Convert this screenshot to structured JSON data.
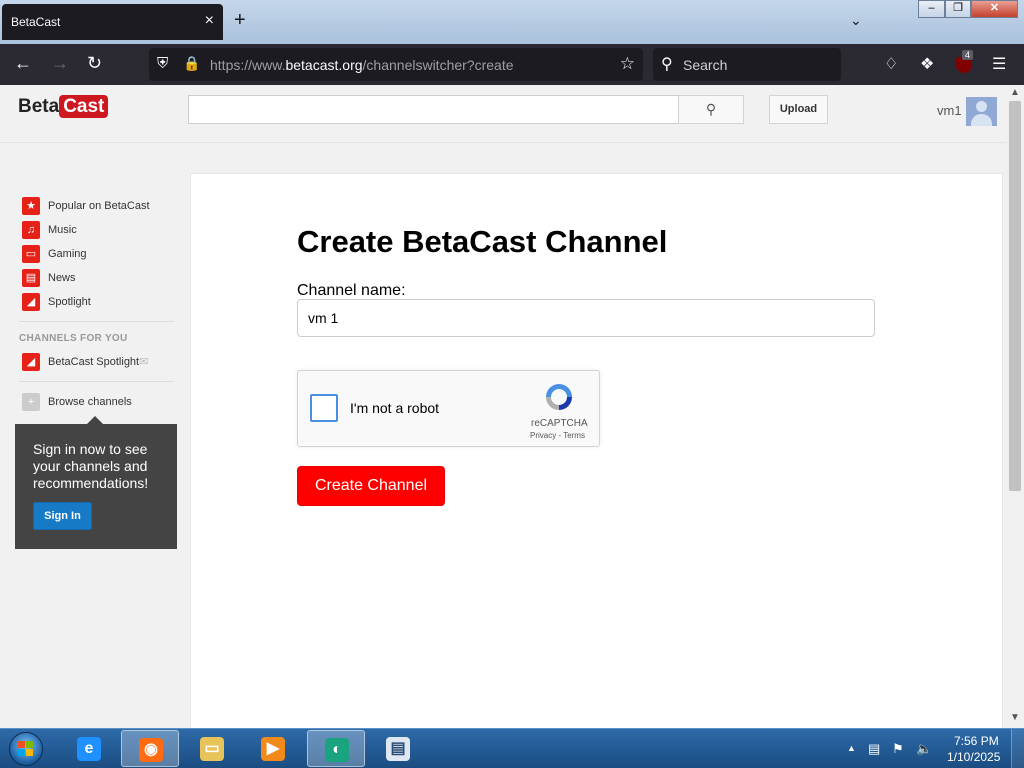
{
  "browser": {
    "tab_title": "BetaCast",
    "tab_close": "×",
    "new_tab": "+",
    "url_prefix": "https://www.",
    "url_domain": "betacast.org",
    "url_path": "/channelswitcher?create",
    "search_placeholder": "Search",
    "extension_badge": "4"
  },
  "site": {
    "logo_part1": "Beta",
    "logo_part2": "Cast",
    "search_value": "",
    "upload_label": "Upload",
    "username": "vm1"
  },
  "sidebar": {
    "guide": [
      {
        "label": "Popular on BetaCast",
        "icon": "star-icon",
        "color": "#e62117",
        "glyph": "★"
      },
      {
        "label": "Music",
        "icon": "headphones-icon",
        "color": "#e62117",
        "glyph": "♫"
      },
      {
        "label": "Gaming",
        "icon": "gamepad-icon",
        "color": "#e62117",
        "glyph": "▭"
      },
      {
        "label": "News",
        "icon": "newspaper-icon",
        "color": "#e62117",
        "glyph": "▤"
      },
      {
        "label": "Spotlight",
        "icon": "spotlight-icon",
        "color": "#e62117",
        "glyph": "◢"
      }
    ],
    "channels_heading": "CHANNELS FOR YOU",
    "channel_items": [
      {
        "label": "BetaCast Spotlight",
        "icon": "spotlight-icon",
        "color": "#e62117",
        "glyph": "◢"
      }
    ],
    "browse_label": "Browse channels",
    "signin_message": "Sign in now to see your channels and recommendations!",
    "signin_button": "Sign In"
  },
  "form": {
    "title": "Create BetaCast Channel",
    "channel_label": "Channel name:",
    "channel_value": "vm 1",
    "captcha_label": "I'm not a robot",
    "captcha_brand": "reCAPTCHA",
    "captcha_links": "Privacy - Terms",
    "submit_label": "Create Channel"
  },
  "taskbar": {
    "time": "7:56 PM",
    "date": "1/10/2025",
    "apps": [
      {
        "name": "ie-icon",
        "color": "#1e90ff",
        "glyph": "e"
      },
      {
        "name": "firefox-icon",
        "color": "#ff6a13",
        "glyph": "◉",
        "active": true
      },
      {
        "name": "file-explorer-icon",
        "color": "#e7c35a",
        "glyph": "▭"
      },
      {
        "name": "media-player-icon",
        "color": "#f28a1b",
        "glyph": "▶"
      },
      {
        "name": "remote-app-icon",
        "color": "#19a37e",
        "glyph": "◐",
        "active": true
      },
      {
        "name": "notepad-icon",
        "color": "#dfe8f2",
        "glyph": "▤"
      }
    ]
  },
  "colors": {
    "accent_red": "#ff0000",
    "brand_red": "#cc181e",
    "signin_blue": "#167ac6",
    "browser_dark": "#2b2a33"
  }
}
